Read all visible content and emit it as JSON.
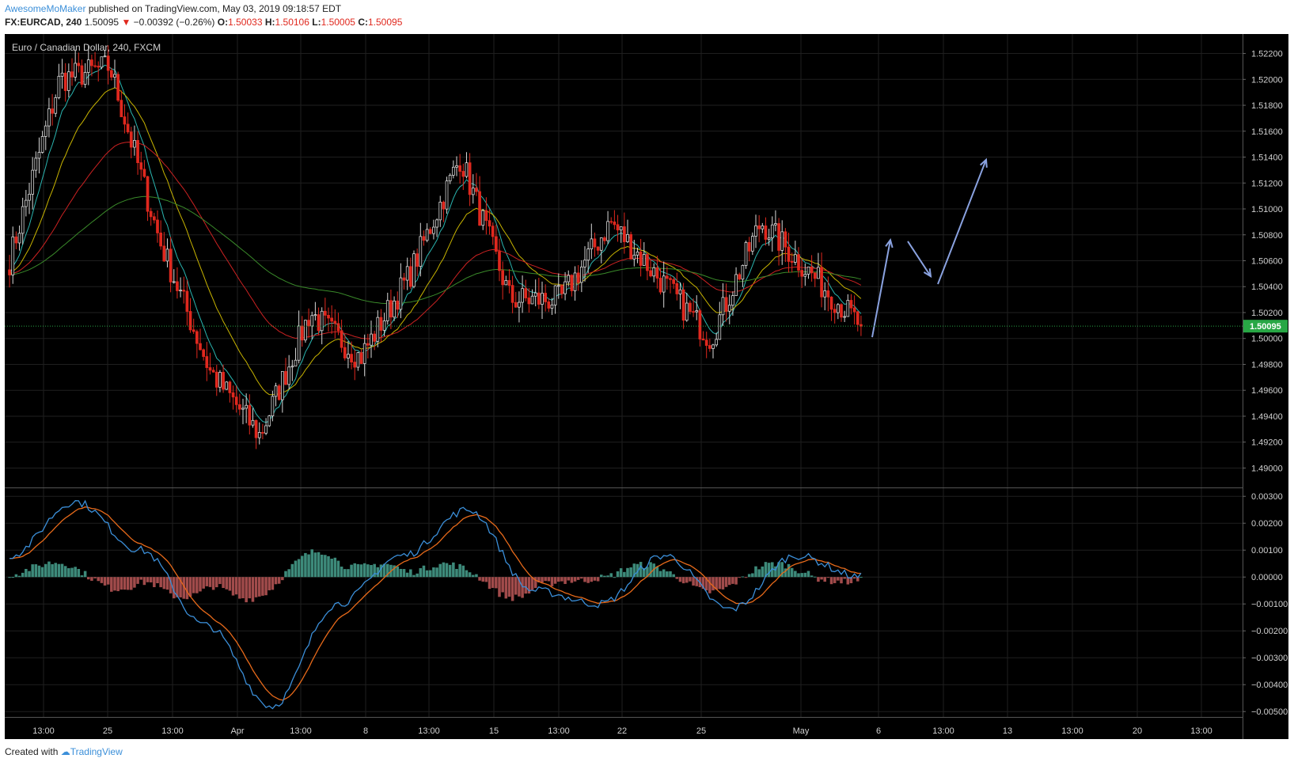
{
  "header": {
    "author": "AwesomeMoMaker",
    "published_text": "published on TradingView.com, May 03, 2019 09:18:57 EDT",
    "symbol": "FX:EURCAD, 240",
    "last": "1.50095",
    "change": "−0.00392 (−0.26%)",
    "o_label": "O:",
    "o_value": "1.50033",
    "h_label": "H:",
    "h_value": "1.50106",
    "l_label": "L:",
    "l_value": "1.50005",
    "c_label": "C:",
    "c_value": "1.50095"
  },
  "colors": {
    "up": "#d8d8d8",
    "down": "#e0281e",
    "background": "#000000",
    "ema_fast": "#2ab5b0",
    "ema_mid": "#c8b400",
    "ema_slow": "#cc2222",
    "ema_long": "#3a8a2a",
    "macd": "#3b8fd9",
    "signal": "#e86a1a",
    "hist_pos": "#3d8a7a",
    "hist_neg": "#a14b4b",
    "price_marker": "#28a745",
    "arrow": "#8aa2e0",
    "brand": "#3b8fd9"
  },
  "footer": {
    "created_with": "Created with",
    "brand": "TradingView"
  },
  "chart_data": [
    {
      "type": "candlestick",
      "title": "Euro / Canadian Dollar, 240, FXCM",
      "ylim": [
        1.4885,
        1.5235
      ],
      "y_ticks": [
        "1.52200",
        "1.52000",
        "1.51800",
        "1.51600",
        "1.51400",
        "1.51200",
        "1.51000",
        "1.50800",
        "1.50600",
        "1.50400",
        "1.50200",
        "1.50000",
        "1.49800",
        "1.49600",
        "1.49400",
        "1.49200",
        "1.49000"
      ],
      "x_labels": [
        "13:00",
        "25",
        "13:00",
        "Apr",
        "13:00",
        "8",
        "13:00",
        "15",
        "13:00",
        "22",
        "25",
        "May",
        "6",
        "13:00",
        "13",
        "13:00",
        "20",
        "13:00"
      ],
      "current_price": 1.50095,
      "current_price_label": "1.50095",
      "key_points": [
        {
          "t": "start",
          "price": 1.506
        },
        {
          "t": "Mar 21",
          "price": 1.52
        },
        {
          "t": "Mar 25",
          "price": 1.521
        },
        {
          "t": "Mar 27",
          "price": 1.5075
        },
        {
          "t": "Mar 29",
          "price": 1.4975
        },
        {
          "t": "Apr 1",
          "price": 1.4925
        },
        {
          "t": "Apr 5",
          "price": 1.502
        },
        {
          "t": "Apr 10",
          "price": 1.4985
        },
        {
          "t": "Apr 15",
          "price": 1.505
        },
        {
          "t": "Apr 16",
          "price": 1.514
        },
        {
          "t": "Apr 18",
          "price": 1.503
        },
        {
          "t": "Apr 22",
          "price": 1.503
        },
        {
          "t": "Apr 24",
          "price": 1.509
        },
        {
          "t": "Apr 25",
          "price": 1.5045
        },
        {
          "t": "Apr 29",
          "price": 1.5
        },
        {
          "t": "Apr 30",
          "price": 1.509
        },
        {
          "t": "May 1",
          "price": 1.505
        },
        {
          "t": "May 3",
          "price": 1.50095
        }
      ],
      "series": [
        {
          "name": "",
          "color_key": "ema_fast"
        },
        {
          "name": "",
          "color_key": "ema_mid"
        },
        {
          "name": "",
          "color_key": "ema_slow"
        },
        {
          "name": "",
          "color_key": "ema_long"
        }
      ],
      "projection": [
        {
          "from": 1.5001,
          "to": 1.5076
        },
        {
          "from": 1.5075,
          "to": 1.5048
        },
        {
          "from": 1.5042,
          "to": 1.5138
        }
      ]
    },
    {
      "type": "line",
      "title": "",
      "ylim": [
        -0.0052,
        0.0033
      ],
      "y_ticks": [
        "0.00300",
        "0.00200",
        "0.00100",
        "0.00000",
        "−0.00100",
        "−0.00200",
        "−0.00300",
        "−0.00400",
        "−0.00500"
      ],
      "macd_key_points": [
        {
          "t": "start",
          "value": 0.0008
        },
        {
          "t": "Mar 21",
          "value": 0.0028
        },
        {
          "t": "Mar 25",
          "value": 0.001
        },
        {
          "t": "Mar 28",
          "value": -0.0018
        },
        {
          "t": "Apr 1",
          "value": -0.0048
        },
        {
          "t": "Apr 5",
          "value": -0.001
        },
        {
          "t": "Apr 9",
          "value": 0.0008
        },
        {
          "t": "Apr 16",
          "value": 0.0025
        },
        {
          "t": "Apr 19",
          "value": -0.0005
        },
        {
          "t": "Apr 22",
          "value": -0.001
        },
        {
          "t": "Apr 24",
          "value": 0.0008
        },
        {
          "t": "Apr 26",
          "value": -0.0012
        },
        {
          "t": "Apr 29",
          "value": 0.0008
        },
        {
          "t": "May 3",
          "value": 0.0
        }
      ],
      "series": [
        {
          "name": "",
          "color_key": "macd"
        },
        {
          "name": "",
          "color_key": "signal"
        },
        {
          "name": "",
          "color_key": "hist_pos",
          "type": "histogram"
        }
      ]
    }
  ]
}
